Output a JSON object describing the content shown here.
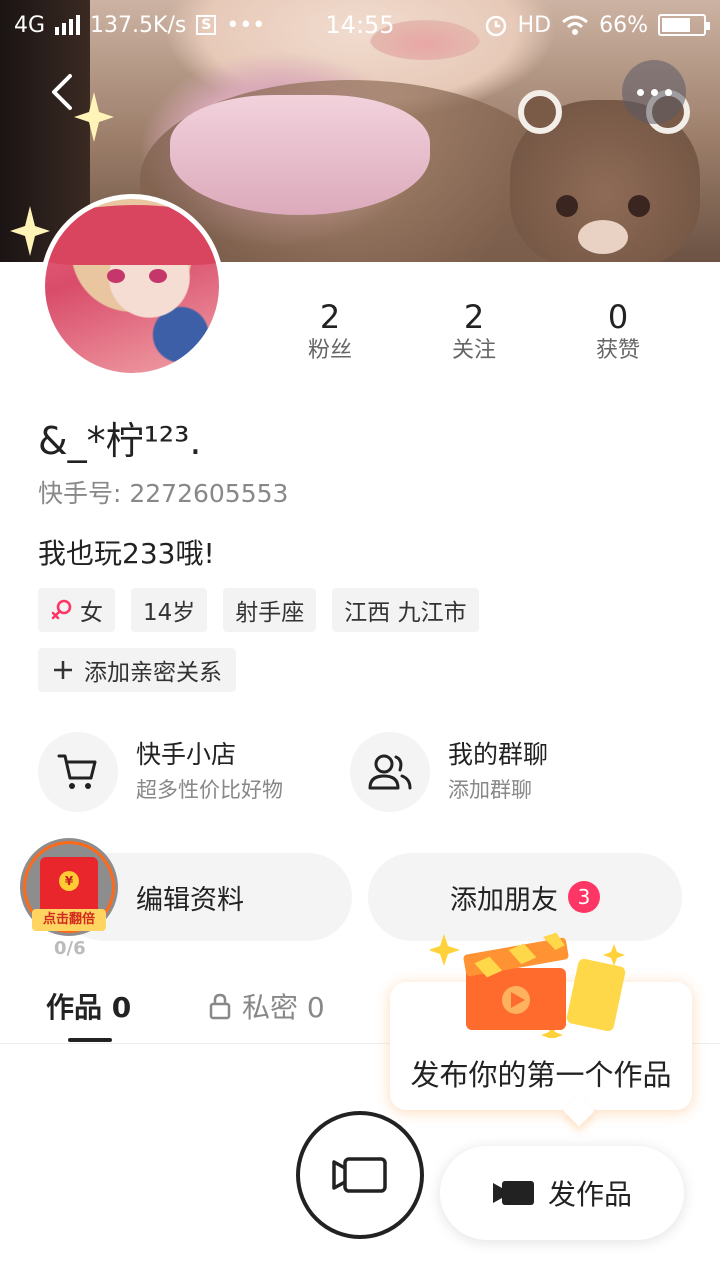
{
  "status_bar": {
    "network": "4G",
    "speed": "137.5K/s",
    "dots": "•••",
    "time": "14:55",
    "hd": "HD",
    "battery_percent": "66%"
  },
  "profile": {
    "username": "&_*柠¹²³.",
    "user_id": "快手号: 2272605553",
    "bio": "我也玩233哦!",
    "stats": [
      {
        "value": "2",
        "label": "粉丝"
      },
      {
        "value": "2",
        "label": "关注"
      },
      {
        "value": "0",
        "label": "获赞"
      }
    ],
    "tags": {
      "gender": "女",
      "age": "14岁",
      "zodiac": "射手座",
      "location": "江西 九江市"
    },
    "add_relation": "添加亲密关系"
  },
  "services": {
    "shop": {
      "title": "快手小店",
      "subtitle": "超多性价比好物"
    },
    "group": {
      "title": "我的群聊",
      "subtitle": "添加群聊"
    }
  },
  "actions": {
    "edit_profile": "编辑资料",
    "add_friends": "添加朋友",
    "add_friends_badge": "3"
  },
  "red_packet": {
    "label": "点击翻倍",
    "coin": "¥",
    "progress": "0/6"
  },
  "tabs": {
    "works": "作品 0",
    "private": "私密 0"
  },
  "tooltip": {
    "text": "发布你的第一个作品"
  },
  "publish_button": "发作品",
  "colors": {
    "accent": "#fe3666",
    "red_packet": "#e8262c",
    "red_packet_ring": "#ff6a1a"
  }
}
